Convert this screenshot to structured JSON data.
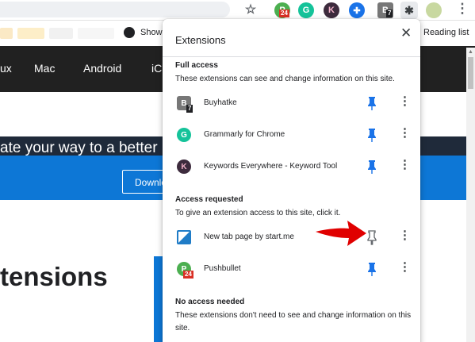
{
  "colors": {
    "accent_blue": "#1a73e8",
    "site_blue": "#0d77d6",
    "nav_dark": "#212121",
    "arrow_red": "#e00000"
  },
  "toolbar": {
    "icons": [
      "star-icon",
      "pushbullet-ext-icon",
      "grammarly-ext-icon",
      "keywords-everywhere-ext-icon",
      "extension-icon",
      "buyhatke-ext-icon",
      "puzzle-icon",
      "profile-avatar",
      "more-vert-icon"
    ],
    "pushbullet_badge": "24",
    "buyhatke_badge": "7"
  },
  "bookmarks": {
    "show_label": "Show",
    "reading_list": "Reading list"
  },
  "site": {
    "nav": [
      "ux",
      "Mac",
      "Android",
      "iC"
    ],
    "hero_text": "ate your way to a better",
    "hero_button": "Downlo",
    "heading": "tensions"
  },
  "popup": {
    "title": "Extensions",
    "full_access": {
      "title": "Full access",
      "description": "These extensions can see and change information on this site.",
      "items": [
        {
          "name": "Buyhatke",
          "badge": "7",
          "pinned": true
        },
        {
          "name": "Grammarly for Chrome",
          "pinned": true
        },
        {
          "name": "Keywords Everywhere - Keyword Tool",
          "pinned": true
        }
      ]
    },
    "access_requested": {
      "title": "Access requested",
      "description": "To give an extension access to this site, click it.",
      "items": [
        {
          "name": "New tab page by start.me",
          "pinned": false
        },
        {
          "name": "Pushbullet",
          "badge": "24",
          "pinned": true
        }
      ]
    },
    "no_access": {
      "title": "No access needed",
      "description": "These extensions don't need to see and change information on this site."
    }
  }
}
